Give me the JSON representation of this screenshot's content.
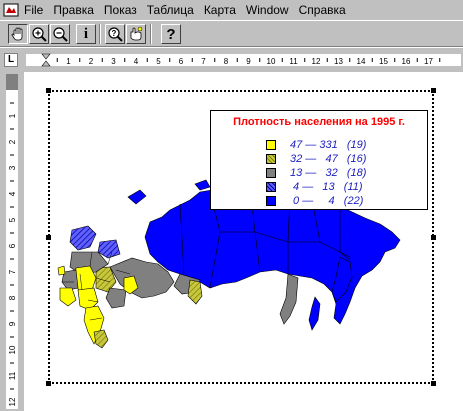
{
  "menu": {
    "items": [
      "File",
      "Правка",
      "Показ",
      "Таблица",
      "Карта",
      "Window",
      "Справка"
    ]
  },
  "toolbar": {
    "buttons": [
      {
        "name": "pan-hand",
        "label": ""
      },
      {
        "name": "zoom-in",
        "label": ""
      },
      {
        "name": "zoom-out",
        "label": ""
      },
      {
        "name": "info",
        "label": "i"
      },
      {
        "name": "query",
        "label": ""
      },
      {
        "name": "select-hand",
        "label": ""
      },
      {
        "name": "help",
        "label": "?"
      }
    ]
  },
  "ruler": {
    "horizontal_numbers": [
      "1",
      "2",
      "3",
      "4",
      "5",
      "6",
      "7",
      "8",
      "9",
      "10",
      "11",
      "12",
      "13",
      "14",
      "15",
      "16",
      "17"
    ],
    "vertical_numbers": [
      "1",
      "2",
      "3",
      "4",
      "5",
      "6",
      "7",
      "8",
      "9",
      "10",
      "11",
      "12"
    ],
    "corner_tab": "L"
  },
  "legend": {
    "title": "Плотность населения на 1995 г.",
    "items": [
      {
        "label": "47 — 331   (19)",
        "color": "#ffff00",
        "pattern": "solid"
      },
      {
        "label": "32 —   47   (16)",
        "color": "#c8c840",
        "pattern": "hatched"
      },
      {
        "label": "13 —   32   (18)",
        "color": "#808080",
        "pattern": "solid"
      },
      {
        "label": " 4 —   13   (11)",
        "color": "#4040ff",
        "pattern": "hatched"
      },
      {
        "label": " 0 —     4   (22)",
        "color": "#0000ff",
        "pattern": "solid"
      }
    ]
  },
  "colors": {
    "chrome": "#c0c0c0",
    "legend_title": "#ff0000",
    "legend_text": "#2020c0",
    "map_dense": "#ffff00",
    "map_sparse": "#0000ff",
    "map_mid": "#808080"
  }
}
